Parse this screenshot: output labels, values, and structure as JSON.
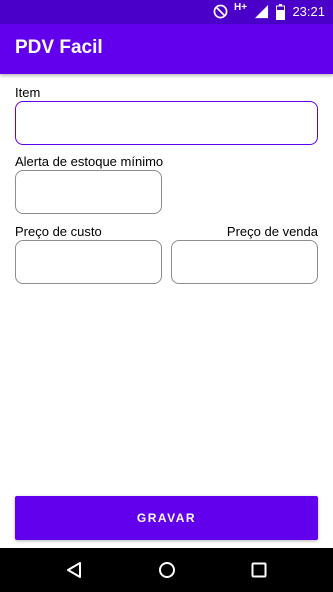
{
  "status_bar": {
    "time": "23:21",
    "network": "H+",
    "icons": [
      "do-not-disturb-icon",
      "signal-icon",
      "battery-icon"
    ]
  },
  "app_bar": {
    "title": "PDV Facil"
  },
  "form": {
    "item_label": "Item",
    "min_stock_label": "Alerta de estoque mínimo",
    "cost_price_label": "Preço de custo",
    "sale_price_label": "Preço de venda"
  },
  "actions": {
    "save_label": "GRAVAR"
  },
  "nav_bar": {
    "icons": [
      "back-icon",
      "home-icon",
      "recents-icon"
    ]
  },
  "colors": {
    "primary": "#6200ee",
    "primary_dark": "#4a00c8"
  }
}
